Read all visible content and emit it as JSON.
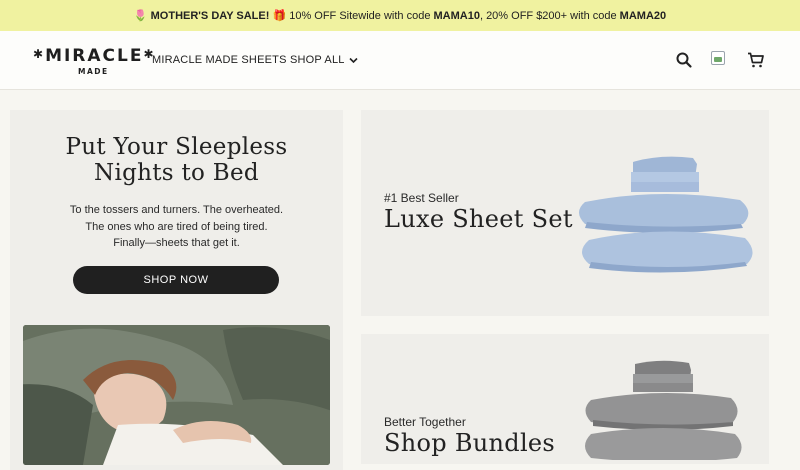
{
  "promo": {
    "icon_flower": "🌷",
    "sale_label": "MOTHER'S DAY SALE!",
    "icon_gift": "🎁",
    "text_1": " 10% OFF Sitewide with code ",
    "code_1": "MAMA10",
    "text_2": ", 20% OFF $200+ with code ",
    "code_2": "MAMA20",
    "bg_color": "#f0f2a0"
  },
  "header": {
    "logo_top": "MIRACLE",
    "logo_bottom": "MADE",
    "nav": {
      "sheets": "MIRACLE MADE SHEETS",
      "shop_all": "SHOP ALL"
    },
    "icons": [
      "search-icon",
      "broken-image-icon",
      "cart-icon"
    ]
  },
  "hero": {
    "title_line_1": "Put Your Sleepless",
    "title_line_2": "Nights to Bed",
    "body_1": "To the tossers and turners. The overheated.",
    "body_2": "The ones who are tired of being tired.",
    "body_3": "Finally—sheets that get it.",
    "cta": "SHOP NOW"
  },
  "products": [
    {
      "eyebrow": "#1 Best Seller",
      "title": "Luxe Sheet Set",
      "color": "#a9bfdc"
    },
    {
      "eyebrow": "Better Together",
      "title": "Shop Bundles",
      "color": "#8f8f90"
    }
  ]
}
